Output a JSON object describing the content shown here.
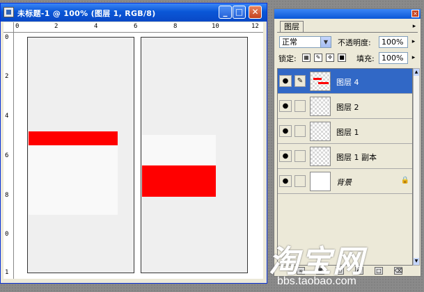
{
  "document_window": {
    "title": "未标题-1 @ 100% (图层 1, RGB/8)",
    "buttons": {
      "minimize": "_",
      "maximize": "□",
      "close": "✕"
    },
    "ruler_top_labels": [
      "0",
      "2",
      "4",
      "6",
      "8",
      "10",
      "12"
    ],
    "ruler_left_labels": [
      "0",
      "2",
      "4",
      "6",
      "8",
      "0",
      "1"
    ]
  },
  "layers_palette": {
    "tab": "图层",
    "menu_arrow": "▸",
    "blend_mode": "正常",
    "opacity_label": "不透明度:",
    "opacity_value": "100%",
    "lock_label": "锁定:",
    "fill_label": "填充:",
    "fill_value": "100%",
    "layers": [
      {
        "name": "图层 4",
        "selected": true,
        "visible": true,
        "thumb": "red-line"
      },
      {
        "name": "图层 2",
        "selected": false,
        "visible": true,
        "thumb": "transparent"
      },
      {
        "name": "图层 1",
        "selected": false,
        "visible": true,
        "thumb": "transparent"
      },
      {
        "name": "图层 1 副本",
        "selected": false,
        "visible": true,
        "thumb": "transparent"
      },
      {
        "name": "背景",
        "selected": false,
        "visible": true,
        "thumb": "white",
        "locked": true
      }
    ]
  },
  "watermark": {
    "logo": "淘宝网",
    "url": "bbs.taobao.com"
  },
  "colors": {
    "accent": "#ff0000",
    "title_bar": "#0a57d7",
    "selected_row": "#3168c6"
  }
}
